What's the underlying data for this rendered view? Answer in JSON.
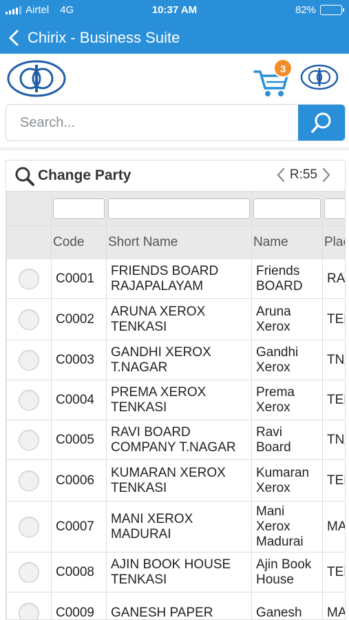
{
  "status": {
    "carrier": "Airtel",
    "network": "4G",
    "time": "10:37 AM",
    "battery": "82%",
    "battery_level": 0.82
  },
  "nav": {
    "title": "Chirix - Business Suite"
  },
  "cart": {
    "count": "3"
  },
  "search": {
    "placeholder": "Search..."
  },
  "panel": {
    "title": "Change Party",
    "page_label": "R:55"
  },
  "table": {
    "headers": {
      "code": "Code",
      "short_name": "Short Name",
      "name": "Name",
      "place": "Plac"
    },
    "rows": [
      {
        "code": "C0001",
        "short_name": "FRIENDS BOARD RAJAPALAYAM",
        "name": "Friends BOARD",
        "place": "RAJ"
      },
      {
        "code": "C0002",
        "short_name": "ARUNA XEROX TENKASI",
        "name": "Aruna Xerox",
        "place": "TEN"
      },
      {
        "code": "C0003",
        "short_name": "GANDHI XEROX T.NAGAR",
        "name": "Gandhi Xerox",
        "place": "TNA"
      },
      {
        "code": "C0004",
        "short_name": "PREMA XEROX TENKASI",
        "name": "Prema Xerox",
        "place": "TEN"
      },
      {
        "code": "C0005",
        "short_name": "RAVI BOARD COMPANY T.NAGAR",
        "name": "Ravi Board",
        "place": "TNA"
      },
      {
        "code": "C0006",
        "short_name": "KUMARAN XEROX TENKASI",
        "name": "Kumaran Xerox",
        "place": "TEN"
      },
      {
        "code": "C0007",
        "short_name": "MANI XEROX MADURAI",
        "name": "Mani Xerox Madurai",
        "place": "MA"
      },
      {
        "code": "C0008",
        "short_name": "AJIN BOOK HOUSE TENKASI",
        "name": "Ajin Book House",
        "place": "TEN"
      },
      {
        "code": "C0009",
        "short_name": "GANESH PAPER",
        "name": "Ganesh",
        "place": "MA"
      }
    ]
  },
  "colors": {
    "primary": "#2a8fd9",
    "badge": "#f28c28",
    "grid_header": "#e9e9e9"
  }
}
